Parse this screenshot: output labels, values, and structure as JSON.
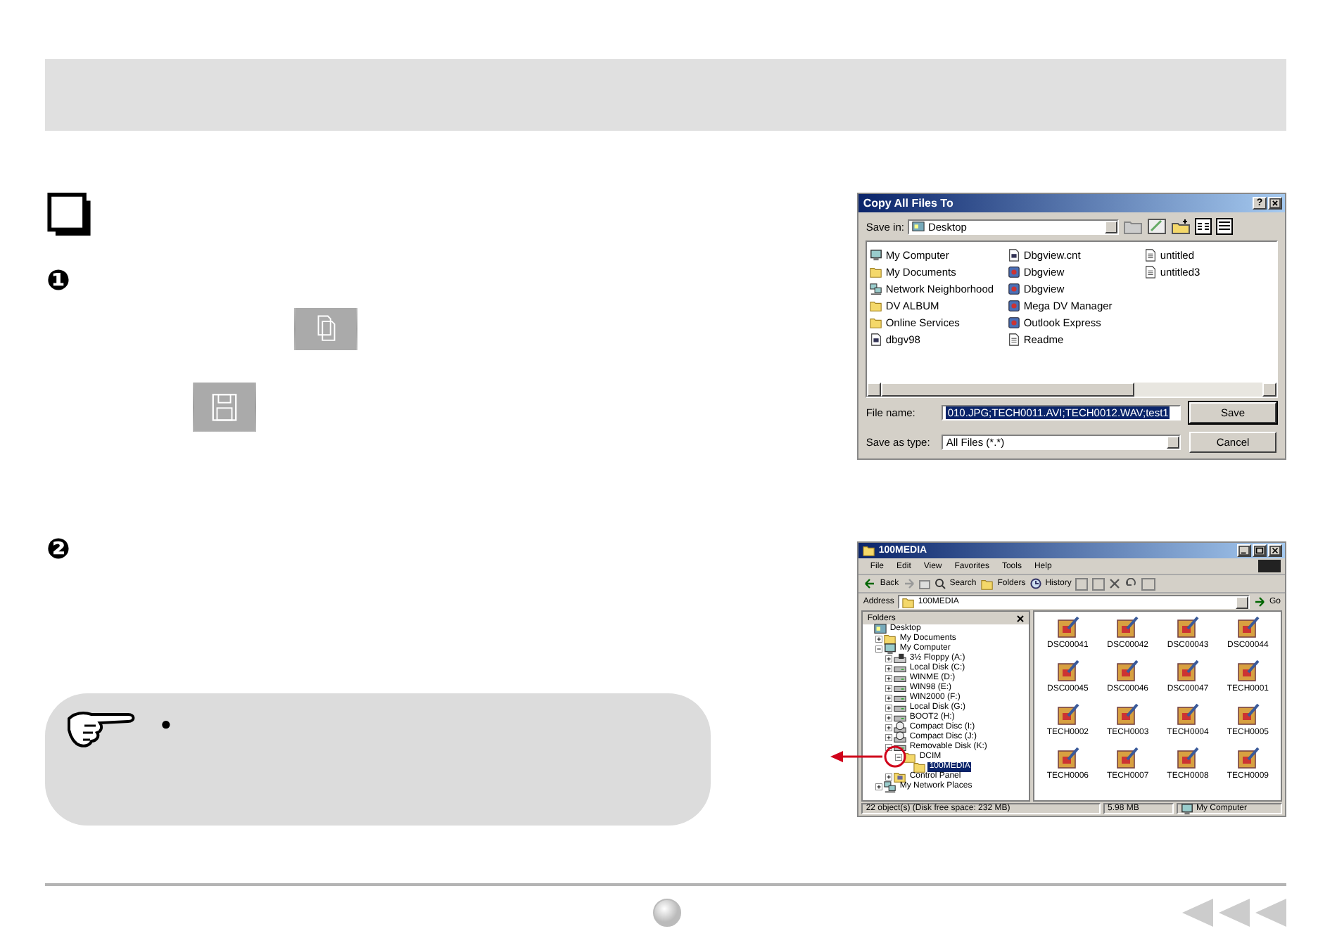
{
  "steps": [
    {
      "number": "❶"
    },
    {
      "number": "❷"
    }
  ],
  "note": {
    "bullet": "●"
  },
  "copy_dialog": {
    "title": "Copy All Files To",
    "help_button": "?",
    "save_in_label": "Save in:",
    "save_in_value": "Desktop",
    "files": [
      {
        "label": "My Computer",
        "kind": "computer"
      },
      {
        "label": "My Documents",
        "kind": "folder"
      },
      {
        "label": "Network Neighborhood",
        "kind": "network"
      },
      {
        "label": "DV ALBUM",
        "kind": "folder"
      },
      {
        "label": "Online Services",
        "kind": "folder"
      },
      {
        "label": "dbgv98",
        "kind": "file"
      },
      {
        "label": "Dbgview.cnt",
        "kind": "file"
      },
      {
        "label": "Dbgview",
        "kind": "app"
      },
      {
        "label": "Dbgview",
        "kind": "app"
      },
      {
        "label": "Mega DV Manager",
        "kind": "app"
      },
      {
        "label": "Outlook Express",
        "kind": "app"
      },
      {
        "label": "Readme",
        "kind": "doc"
      },
      {
        "label": "untitled",
        "kind": "doc"
      },
      {
        "label": "untitled3",
        "kind": "doc"
      }
    ],
    "file_name_label": "File name:",
    "file_name_value": "010.JPG;TECH0011.AVI;TECH0012.WAV;test1",
    "save_as_type_label": "Save as type:",
    "save_as_type_value": "All Files (*.*)",
    "buttons": [
      "Save",
      "Cancel"
    ]
  },
  "explorer_window": {
    "title": "100MEDIA",
    "menu": [
      "File",
      "Edit",
      "View",
      "Favorites",
      "Tools",
      "Help"
    ],
    "toolbar": [
      "Back",
      "Search",
      "Folders",
      "History"
    ],
    "address_label": "Address",
    "address_value": "100MEDIA",
    "go_button": "Go",
    "folders_header": "Folders",
    "tree": [
      {
        "label": "Desktop",
        "kind": "desktop",
        "selected": false,
        "children": [
          {
            "label": "My Documents",
            "kind": "folder",
            "selected": false,
            "expanded": false
          },
          {
            "label": "My Computer",
            "kind": "computer",
            "selected": false,
            "expanded": true,
            "children": [
              {
                "label": "3½ Floppy (A:)",
                "kind": "floppy",
                "selected": false,
                "expanded": false
              },
              {
                "label": "Local Disk (C:)",
                "kind": "drive",
                "selected": false,
                "expanded": false
              },
              {
                "label": "WINME (D:)",
                "kind": "drive",
                "selected": false,
                "expanded": false
              },
              {
                "label": "WIN98 (E:)",
                "kind": "drive",
                "selected": false,
                "expanded": false
              },
              {
                "label": "WIN2000 (F:)",
                "kind": "drive",
                "selected": false,
                "expanded": false
              },
              {
                "label": "Local Disk (G:)",
                "kind": "drive",
                "selected": false,
                "expanded": false
              },
              {
                "label": "BOOT2 (H:)",
                "kind": "drive",
                "selected": false,
                "expanded": false
              },
              {
                "label": "Compact Disc (I:)",
                "kind": "cd",
                "selected": false,
                "expanded": false
              },
              {
                "label": "Compact Disc (J:)",
                "kind": "cd",
                "selected": false,
                "expanded": false
              },
              {
                "label": "Removable Disk (K:)",
                "kind": "drive",
                "selected": false,
                "expanded": true,
                "children": [
                  {
                    "label": "DCIM",
                    "kind": "folder",
                    "selected": false,
                    "expanded": true,
                    "children": [
                      {
                        "label": "100MEDIA",
                        "kind": "folder",
                        "selected": true
                      }
                    ]
                  }
                ]
              },
              {
                "label": "Control Panel",
                "kind": "control-panel",
                "selected": false,
                "expanded": false
              }
            ]
          },
          {
            "label": "My Network Places",
            "kind": "network",
            "selected": false,
            "expanded": false
          }
        ]
      }
    ],
    "files": [
      "DSC00041",
      "DSC00042",
      "DSC00043",
      "DSC00044",
      "DSC00045",
      "DSC00046",
      "DSC00047",
      "TECH0001",
      "TECH0002",
      "TECH0003",
      "TECH0004",
      "TECH0005",
      "TECH0006",
      "TECH0007",
      "TECH0008",
      "TECH0009"
    ],
    "status": [
      "22 object(s) (Disk free space: 232 MB)",
      "5.98 MB",
      "My Computer"
    ]
  }
}
